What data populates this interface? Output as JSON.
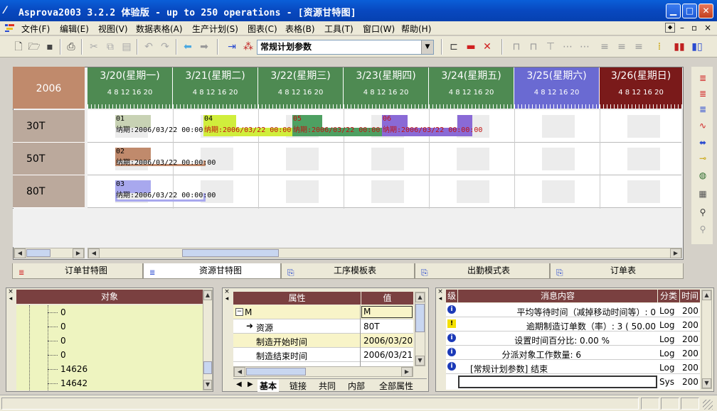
{
  "window": {
    "title": "Asprova2003 3.2.2 体验版  - up to 250 operations - [资源甘特图]"
  },
  "menu": [
    "文件(F)",
    "编辑(E)",
    "视图(V)",
    "数据表格(A)",
    "生产计划(S)",
    "图表(C)",
    "表格(B)",
    "工具(T)",
    "窗口(W)",
    "帮助(H)"
  ],
  "toolbar": {
    "combo_value": "常规计划参数"
  },
  "gantt": {
    "year": "2006",
    "hour_ticks": "4  8  12  16  20",
    "days": [
      {
        "label": "3/20(星期一)",
        "color": "#4e8a52"
      },
      {
        "label": "3/21(星期二)",
        "color": "#4e8a52"
      },
      {
        "label": "3/22(星期三)",
        "color": "#4e8a52"
      },
      {
        "label": "3/23(星期四)",
        "color": "#4e8a52"
      },
      {
        "label": "3/24(星期五)",
        "color": "#4e8a52"
      },
      {
        "label": "3/25(星期六)",
        "color": "#6a6ad2"
      },
      {
        "label": "3/26(星期日)",
        "color": "#7a1a1a"
      }
    ],
    "resources": [
      "30T",
      "50T",
      "80T"
    ],
    "tasks": [
      {
        "id": "01",
        "due": "纳期:2006/03/22 00:00:00",
        "color": "#c8d2b4"
      },
      {
        "id": "04",
        "due": "纳期:2006/03/22 00:00:00",
        "color": "#d0ee3c"
      },
      {
        "id": "05",
        "due": "纳期:2006/03/22 00:00:00",
        "color": "#4ea062"
      },
      {
        "id": "06",
        "due": "纳期:2006/03/22 00:00:00",
        "color": "#8a6ad6"
      },
      {
        "id": "02",
        "due": "纳期:2006/03/22 00:00:00",
        "color": "#c08a6c"
      },
      {
        "id": "03",
        "due": "纳期:2006/03/22 00:00:00",
        "color": "#a8a8ee"
      }
    ]
  },
  "tabs": [
    "订单甘特图",
    "资源甘特图",
    "工序模板表",
    "出勤模式表",
    "订单表"
  ],
  "object_panel": {
    "header": "对象",
    "items": [
      "0",
      "0",
      "0",
      "0",
      "14626",
      "14642"
    ]
  },
  "property_panel": {
    "col_attr": "属性",
    "col_value": "值",
    "rows": [
      {
        "attr": "M",
        "value": "M"
      },
      {
        "attr": "资源",
        "value": "80T"
      },
      {
        "attr": "制造开始时间",
        "value": "2006/03/20"
      },
      {
        "attr": "制造结束时间",
        "value": "2006/03/21"
      }
    ],
    "tabs": [
      "基本",
      "链接",
      "共同",
      "内部",
      "全部属性"
    ]
  },
  "message_panel": {
    "col_level": "级",
    "col_content": "消息内容",
    "col_category": "分类",
    "col_time": "时间",
    "rows": [
      {
        "icon": "info",
        "text": "平均等待时间（减掉移动时间等）: 0",
        "cat": "Log",
        "time": "200"
      },
      {
        "icon": "warn",
        "text": "逾期制造订单数（率）: 3 ( 50.00",
        "cat": "Log",
        "time": "200"
      },
      {
        "icon": "info",
        "text": "设置时间百分比:  0.00 %",
        "cat": "Log",
        "time": "200"
      },
      {
        "icon": "info",
        "text": "分派对象工作数量:  6",
        "cat": "Log",
        "time": "200"
      },
      {
        "icon": "info",
        "text": "[常规计划参数] 结束",
        "cat": "Log",
        "time": "200"
      },
      {
        "icon": "",
        "text": "",
        "cat": "Sys",
        "time": "200"
      }
    ]
  }
}
